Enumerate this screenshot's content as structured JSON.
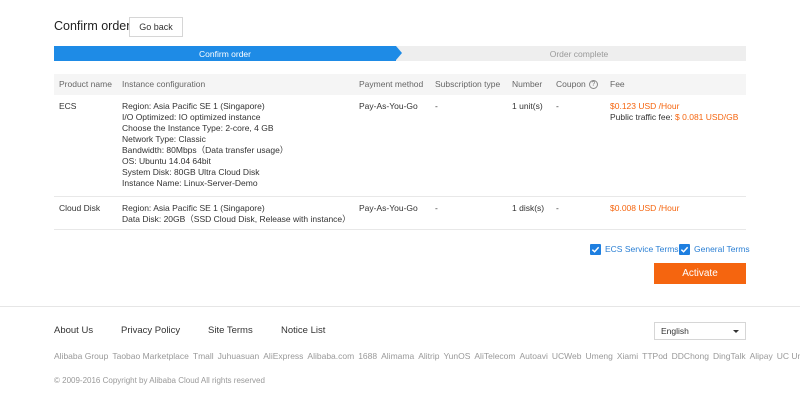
{
  "header": {
    "title": "Confirm order",
    "back_label": "Go back"
  },
  "steps": {
    "active": "Confirm order",
    "pending": "Order complete"
  },
  "table": {
    "headers": {
      "product": "Product name",
      "config": "Instance configuration",
      "payment": "Payment method",
      "subscription": "Subscription type",
      "number": "Number",
      "coupon": "Coupon",
      "fee": "Fee"
    },
    "rows": [
      {
        "product": "ECS",
        "config": [
          "Region: Asia Pacific SE 1 (Singapore)",
          "I/O Optimized: IO optimized instance",
          "Choose the Instance Type: 2-core, 4 GB",
          "Network Type: Classic",
          "Bandwidth: 80Mbps（Data transfer usage）",
          "OS: Ubuntu 14.04 64bit",
          "System Disk: 80GB Ultra Cloud Disk",
          "Instance Name: Linux-Server-Demo"
        ],
        "payment": "Pay-As-You-Go",
        "subscription": "-",
        "number": "1 unit(s)",
        "coupon": "-",
        "fee": "$0.123 USD /Hour",
        "fee_extra_label": "Public traffic fee: ",
        "fee_extra_value": "$ 0.081 USD/GB"
      },
      {
        "product": "Cloud Disk",
        "config": [
          "Region: Asia Pacific SE 1 (Singapore)",
          "Data Disk: 20GB（SSD Cloud Disk, Release with instance）"
        ],
        "payment": "Pay-As-You-Go",
        "subscription": "-",
        "number": "1 disk(s)",
        "coupon": "-",
        "fee": "$0.008 USD /Hour"
      }
    ]
  },
  "terms": {
    "ecs": "ECS Service Terms",
    "general": "General Terms",
    "ecs_checked": true,
    "general_checked": true
  },
  "activate_label": "Activate",
  "footer": {
    "links": [
      "About Us",
      "Privacy Policy",
      "Site Terms",
      "Notice List"
    ],
    "language": "English",
    "partners": [
      "Alibaba Group",
      "Taobao Marketplace",
      "Tmall",
      "Juhuasuan",
      "AliExpress",
      "Alibaba.com",
      "1688",
      "Alimama",
      "Alitrip",
      "YunOS",
      "AliTelecom",
      "Autoavi",
      "UCWeb",
      "Umeng",
      "Xiami",
      "TTPod",
      "DDChong",
      "DingTalk",
      "Alipay",
      "UC Union"
    ],
    "copyright": "© 2009-2016 Copyright by Alibaba Cloud All rights reserved"
  },
  "colors": {
    "accent_blue": "#1e8be6",
    "accent_orange": "#f5650f"
  }
}
